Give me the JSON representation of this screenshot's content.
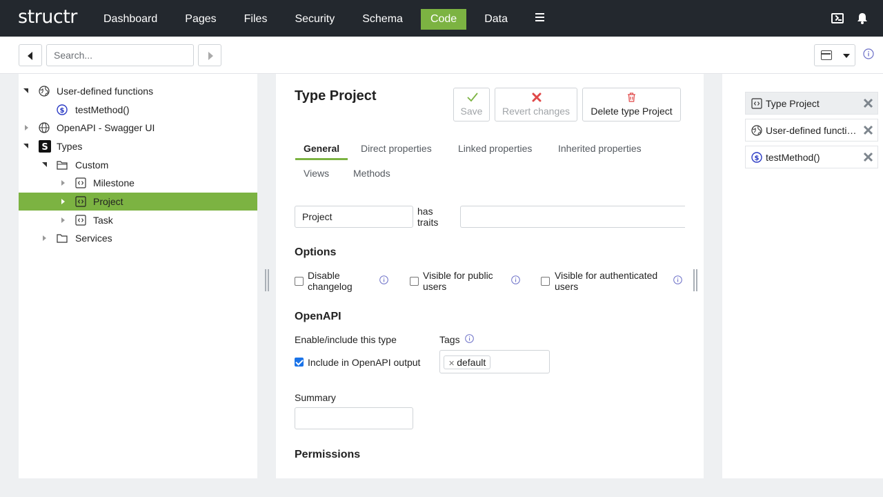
{
  "header": {
    "logo": "structr",
    "nav": [
      {
        "label": "Dashboard"
      },
      {
        "label": "Pages"
      },
      {
        "label": "Files"
      },
      {
        "label": "Security"
      },
      {
        "label": "Schema"
      },
      {
        "label": "Code",
        "active": true
      },
      {
        "label": "Data"
      }
    ],
    "accent_color": "#7cb342",
    "bg_color": "#23282e"
  },
  "toolbar": {
    "search_placeholder": "Search..."
  },
  "tree": {
    "items": [
      {
        "label": "User-defined functions",
        "icon": "globe-icon",
        "expanded": true
      },
      {
        "label": "testMethod()",
        "icon": "method-icon"
      },
      {
        "label": "OpenAPI - Swagger UI",
        "icon": "globe-icon",
        "expanded": false
      },
      {
        "label": "Types",
        "icon": "structr-icon",
        "expanded": true
      },
      {
        "label": "Custom",
        "icon": "folder-icon",
        "expanded": true
      },
      {
        "label": "Milestone",
        "icon": "type-icon",
        "expanded": false
      },
      {
        "label": "Project",
        "icon": "type-icon",
        "expanded": false,
        "selected": true
      },
      {
        "label": "Task",
        "icon": "type-icon",
        "expanded": false
      },
      {
        "label": "Services",
        "icon": "folder-icon",
        "expanded": false
      }
    ]
  },
  "editor": {
    "title": "Type Project",
    "save_label": "Save",
    "revert_label": "Revert changes",
    "delete_label": "Delete type Project",
    "tabs": [
      {
        "label": "General",
        "active": true
      },
      {
        "label": "Direct properties"
      },
      {
        "label": "Linked properties"
      },
      {
        "label": "Inherited properties"
      },
      {
        "label": "Views"
      },
      {
        "label": "Methods"
      }
    ],
    "name_value": "Project",
    "has_traits_label": "has traits",
    "options_title": "Options",
    "options": [
      {
        "label": "Disable changelog",
        "checked": false
      },
      {
        "label": "Visible for public users",
        "checked": false
      },
      {
        "label": "Visible for authenticated users",
        "checked": false
      }
    ],
    "openapi_title": "OpenAPI",
    "enable_label": "Enable/include this type",
    "include_label": "Include in OpenAPI output",
    "include_checked": true,
    "tags_label": "Tags",
    "tags": [
      "default"
    ],
    "summary_label": "Summary",
    "summary_value": "",
    "permissions_title": "Permissions"
  },
  "context": {
    "items": [
      {
        "label": "Type Project",
        "icon": "type-icon",
        "active": true
      },
      {
        "label": "User-defined functions",
        "icon": "globe-icon"
      },
      {
        "label": "testMethod()",
        "icon": "method-icon"
      }
    ]
  }
}
